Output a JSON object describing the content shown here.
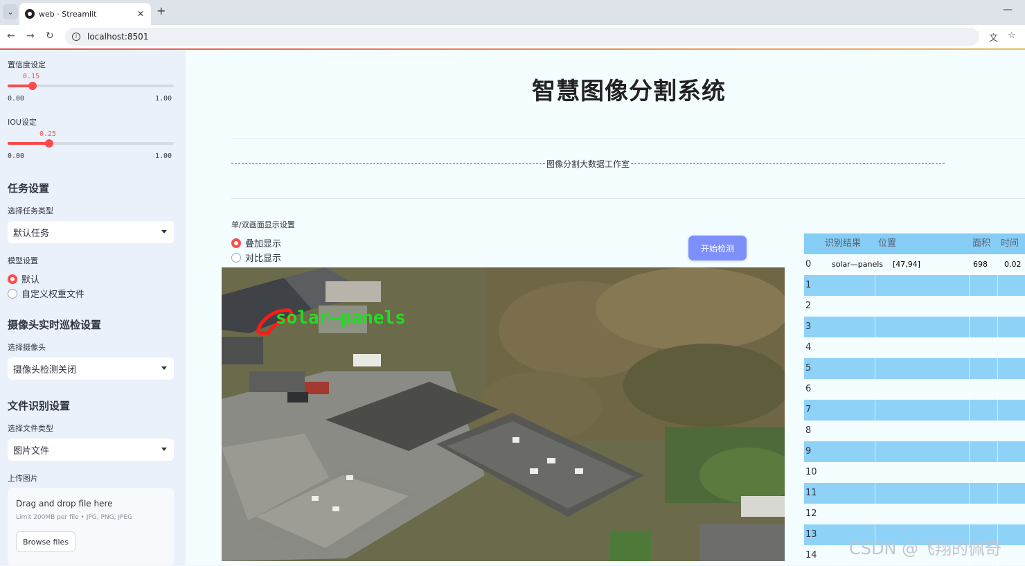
{
  "browser": {
    "tab_title": "web · Streamlit",
    "url": "localhost:8501"
  },
  "sidebar": {
    "confidence": {
      "label": "置信度设定",
      "value": "0.15",
      "level": 0.15,
      "min": "0.00",
      "max": "1.00"
    },
    "iou": {
      "label": "IOU设定",
      "value": "0.25",
      "level": 0.25,
      "min": "0.00",
      "max": "1.00"
    },
    "task_heading": "任务设置",
    "task_type_label": "选择任务类型",
    "task_type_value": "默认任务",
    "model_label": "模型设置",
    "model_options": [
      "默认",
      "自定义权重文件"
    ],
    "camera_heading": "摄像头实时巡检设置",
    "camera_label": "选择摄像头",
    "camera_value": "摄像头检测关闭",
    "file_heading": "文件识别设置",
    "file_type_label": "选择文件类型",
    "file_type_value": "图片文件",
    "upload_label": "上传图片",
    "upload_title": "Drag and drop file here",
    "upload_limit": "Limit 200MB per file • JPG, PNG, JPEG",
    "browse_label": "Browse files"
  },
  "main": {
    "title": "智慧图像分割系统",
    "subtitle": "图像分割大数据工作室",
    "display_mode_label": "单/双画面显示设置",
    "display_modes": [
      "叠加显示",
      "对比显示"
    ],
    "detect_button": "开始检测",
    "detection_label": "solar—panels"
  },
  "results_table": {
    "headers": [
      "识别结果",
      "位置",
      "面积",
      "时间"
    ],
    "rows": [
      {
        "index": "0",
        "result": "solar—panels",
        "position": "[47,94]",
        "area": "698",
        "time": "0.02"
      },
      {
        "index": "1"
      },
      {
        "index": "2"
      },
      {
        "index": "3"
      },
      {
        "index": "4"
      },
      {
        "index": "5"
      },
      {
        "index": "6"
      },
      {
        "index": "7"
      },
      {
        "index": "8"
      },
      {
        "index": "9"
      },
      {
        "index": "10"
      },
      {
        "index": "11"
      },
      {
        "index": "12"
      },
      {
        "index": "13"
      },
      {
        "index": "14"
      }
    ]
  },
  "watermark": "CSDN @飞翔的佩奇",
  "colors": {
    "accent": "#ff4b4b",
    "button": "#7c8ffb",
    "table_stripe": "#8fd2f8",
    "detection_outline": "#ff1a1a",
    "detection_text": "#22dd22"
  }
}
